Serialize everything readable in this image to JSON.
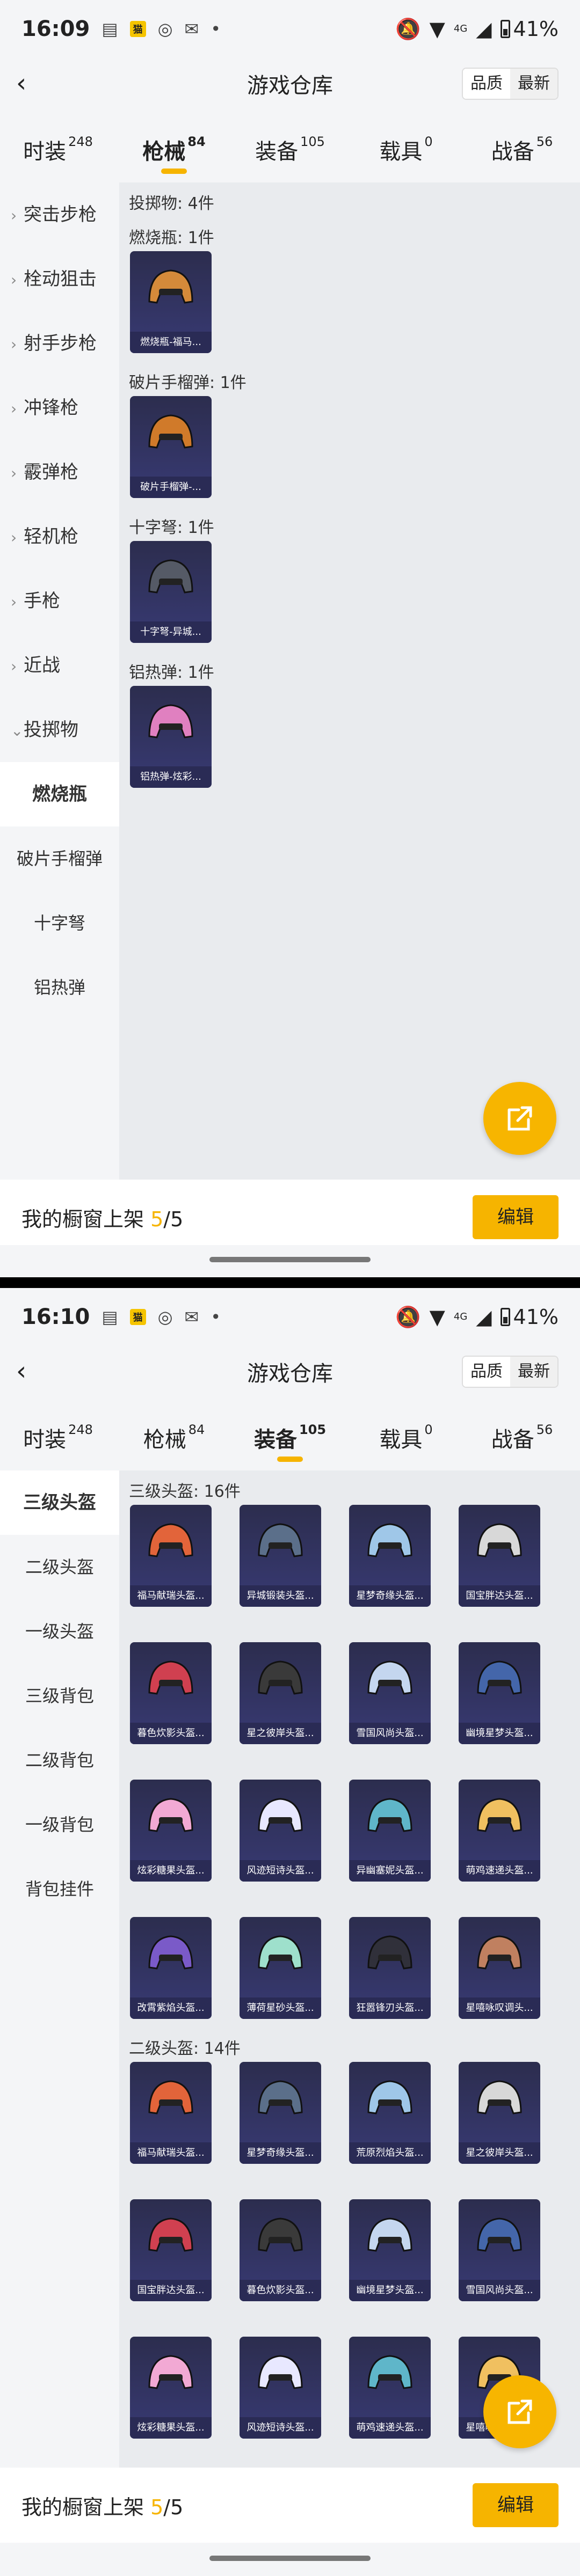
{
  "screens": [
    {
      "status": {
        "time": "16:09",
        "badge": "猫",
        "battery": "41%",
        "net": "4G"
      },
      "title": "游戏仓库",
      "sort": [
        "品质",
        "最新"
      ],
      "tabs": [
        {
          "label": "时装",
          "count": "248"
        },
        {
          "label": "枪械",
          "count": "84"
        },
        {
          "label": "装备",
          "count": "105"
        },
        {
          "label": "载具",
          "count": "0"
        },
        {
          "label": "战备",
          "count": "56"
        }
      ],
      "active_tab": "枪械",
      "sidebar": [
        {
          "label": "突击步枪",
          "chev": "›"
        },
        {
          "label": "栓动狙击",
          "chev": "›"
        },
        {
          "label": "射手步枪",
          "chev": "›"
        },
        {
          "label": "冲锋枪",
          "chev": "›"
        },
        {
          "label": "霰弹枪",
          "chev": "›"
        },
        {
          "label": "轻机枪",
          "chev": "›"
        },
        {
          "label": "手枪",
          "chev": "›"
        },
        {
          "label": "近战",
          "chev": "›"
        },
        {
          "label": "投掷物",
          "chev": "⌄"
        },
        {
          "label": "燃烧瓶"
        },
        {
          "label": "破片手榴弹"
        },
        {
          "label": "十字弩"
        },
        {
          "label": "铝热弹"
        }
      ],
      "summary": "投掷物: 4件",
      "sections": [
        {
          "title": "燃烧瓶: 1件",
          "items": [
            "燃烧瓶-福马..."
          ]
        },
        {
          "title": "破片手榴弹: 1件",
          "items": [
            "破片手榴弹-..."
          ]
        },
        {
          "title": "十字弩: 1件",
          "items": [
            "十字弩-异城..."
          ]
        },
        {
          "title": "铝热弹: 1件",
          "items": [
            "铝热弹-炫彩..."
          ]
        }
      ],
      "bottom": {
        "label": "我的橱窗上架 ",
        "count": "5",
        "total": "/5",
        "edit": "编辑"
      }
    },
    {
      "status": {
        "time": "16:10",
        "badge": "猫",
        "battery": "41%",
        "net": "4G"
      },
      "title": "游戏仓库",
      "sort": [
        "品质",
        "最新"
      ],
      "tabs": [
        {
          "label": "时装",
          "count": "248"
        },
        {
          "label": "枪械",
          "count": "84"
        },
        {
          "label": "装备",
          "count": "105"
        },
        {
          "label": "载具",
          "count": "0"
        },
        {
          "label": "战备",
          "count": "56"
        }
      ],
      "active_tab": "装备",
      "sidebar": [
        {
          "label": "三级头盔"
        },
        {
          "label": "二级头盔"
        },
        {
          "label": "一级头盔"
        },
        {
          "label": "三级背包"
        },
        {
          "label": "二级背包"
        },
        {
          "label": "一级背包"
        },
        {
          "label": "背包挂件"
        }
      ],
      "sections": [
        {
          "title": "三级头盔: 16件",
          "items": [
            "福马献瑞头盔...",
            "异城锻装头盔...",
            "星梦奇缘头盔...",
            "国宝胖达头盔...",
            "暮色炊影头盔...",
            "星之彼岸头盔...",
            "雪国风尚头盔...",
            "幽境星梦头盔...",
            "炫彩糖果头盔...",
            "风迹短诗头盔...",
            "异幽塞妮头盔...",
            "萌鸡速递头盔...",
            "改霄紫焰头盔...",
            "薄荷星砂头盔...",
            "狂嚣锋刃头盔...",
            "星嘻咏叹调头..."
          ]
        },
        {
          "title": "二级头盔: 14件",
          "items": [
            "福马献瑞头盔...",
            "星梦奇缘头盔...",
            "荒原烈焰头盔...",
            "星之彼岸头盔...",
            "国宝胖达头盔...",
            "暮色炊影头盔...",
            "幽境星梦头盔...",
            "雪国风尚头盔...",
            "炫彩糖果头盔...",
            "风迹短诗头盔...",
            "萌鸡速递头盔...",
            "星嘻咏叹调头..."
          ]
        }
      ],
      "bottom": {
        "label": "我的橱窗上架 ",
        "count": "5",
        "total": "/5",
        "edit": "编辑"
      }
    }
  ],
  "colors": {
    "accent": "#f6b400",
    "card_bg": "#32335e"
  }
}
